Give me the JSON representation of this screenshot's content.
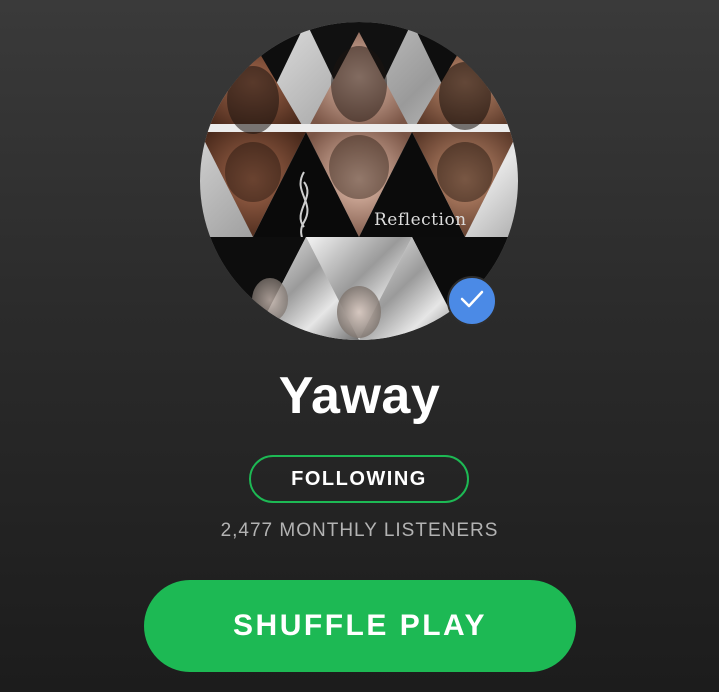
{
  "artist": {
    "name": "Yaway",
    "verified": true,
    "avatar_caption": "Reflection",
    "monthly_listeners": "2,477 MONTHLY LISTENERS"
  },
  "actions": {
    "follow_label": "FOLLOWING",
    "shuffle_label": "SHUFFLE PLAY"
  },
  "colors": {
    "accent": "#1db954",
    "verified_badge": "#4b8ae6",
    "background_top": "#3a3a3a",
    "background_bottom": "#1c1c1c",
    "secondary_text": "#b3b3b3"
  },
  "icons": {
    "verified": "checkmark-icon"
  }
}
